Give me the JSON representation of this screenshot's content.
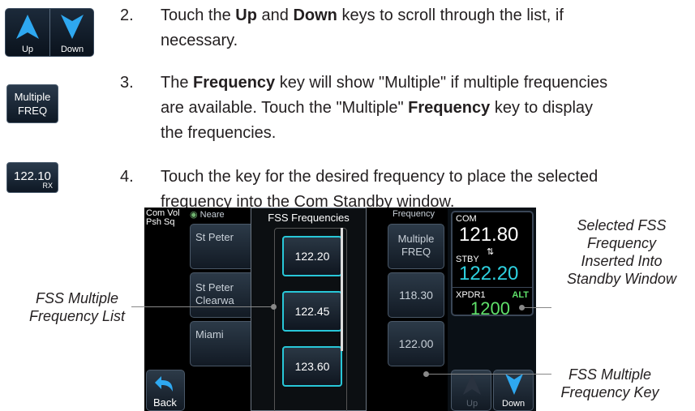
{
  "keys": {
    "up_label": "Up",
    "down_label": "Down",
    "multiple_freq_line1": "Multiple",
    "multiple_freq_line2": "FREQ",
    "rx_freq": "122.10",
    "rx_tag": "RX"
  },
  "steps": {
    "s2": {
      "num": "2.",
      "t1": "Touch the ",
      "b1": "Up",
      "t2": " and ",
      "b2": "Down",
      "t3": " keys to scroll through the list, if",
      "cont": "necessary."
    },
    "s3": {
      "num": "3.",
      "t1": "The ",
      "b1": "Frequency",
      "t2": " key will show \"Multiple\" if multiple frequencies",
      "line2a": "are available. Touch the \"Multiple\" ",
      "line2b": "Frequency",
      "line2c": " key to display",
      "line3": "the frequencies."
    },
    "s4": {
      "num": "4.",
      "line1": "Touch the key for the desired frequency to place the selected",
      "line2": "frequency into the Com Standby window."
    }
  },
  "screen": {
    "com_vol": "Com Vol",
    "psh_sq": "Psh Sq",
    "nearest_tab": "Neare",
    "frequency_tab": "Frequency",
    "popup_title": "FSS Frequencies",
    "list": [
      {
        "name": "St Peter",
        "freq_l1": "Multiple",
        "freq_l2": "FREQ"
      },
      {
        "name": "St Peter",
        "name2": "Clearwa",
        "freq": "118.30"
      },
      {
        "name": "Miami",
        "freq": "122.00"
      }
    ],
    "popup_freqs": [
      "122.20",
      "122.45",
      "123.60"
    ],
    "back_label": "Back",
    "com_label": "COM",
    "com_active": "121.80",
    "stby_label": "STBY",
    "com_standby": "122.20",
    "xpdr_label": "XPDR1",
    "alt_label": "ALT",
    "squawk": "1200",
    "up_label": "Up",
    "down_label": "Down"
  },
  "annotations": {
    "left": [
      "FSS Multiple",
      "Frequency List"
    ],
    "right_top": [
      "Selected FSS",
      "Frequency",
      "Inserted Into",
      "Standby Window"
    ],
    "right_bottom": [
      "FSS Multiple",
      "Frequency Key"
    ]
  },
  "colors": {
    "highlight_cyan": "#28c7d8",
    "standby_cyan": "#2ed1e0",
    "alt_green": "#5fe06a"
  }
}
